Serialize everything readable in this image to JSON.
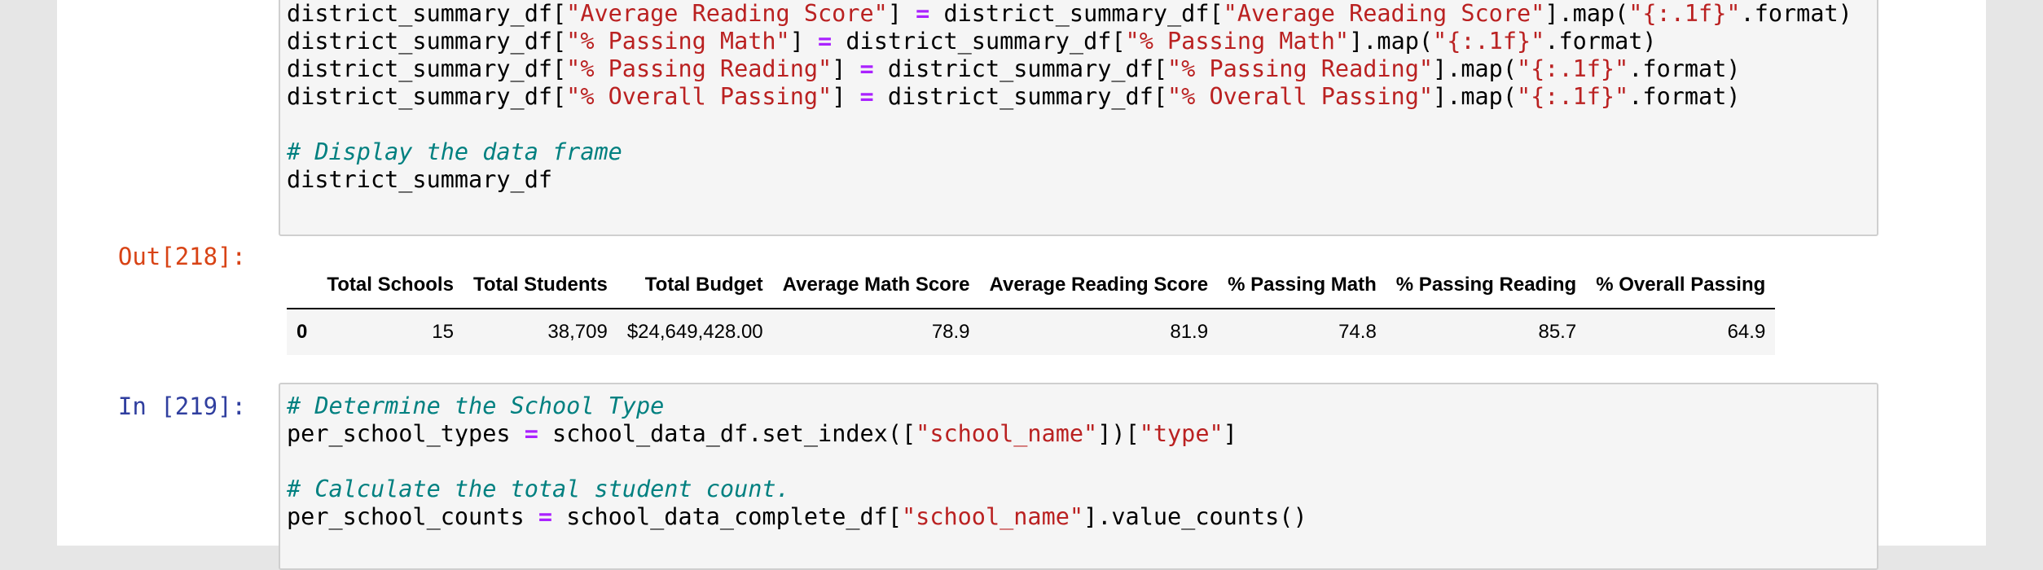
{
  "cell1": {
    "code_lines": [
      "district_summary_df[\"Average Reading Score\"] = district_summary_df[\"Average Reading Score\"].map(\"{:.1f}\".format)",
      "district_summary_df[\"% Passing Math\"] = district_summary_df[\"% Passing Math\"].map(\"{:.1f}\".format)",
      "district_summary_df[\"% Passing Reading\"] = district_summary_df[\"% Passing Reading\"].map(\"{:.1f}\".format)",
      "district_summary_df[\"% Overall Passing\"] = district_summary_df[\"% Overall Passing\"].map(\"{:.1f}\".format)",
      "",
      "# Display the data frame",
      "district_summary_df"
    ]
  },
  "output": {
    "prompt": "Out[218]:",
    "columns": [
      "",
      "Total Schools",
      "Total Students",
      "Total Budget",
      "Average Math Score",
      "Average Reading Score",
      "% Passing Math",
      "% Passing Reading",
      "% Overall Passing"
    ],
    "rows": [
      [
        "0",
        "15",
        "38,709",
        "$24,649,428.00",
        "78.9",
        "81.9",
        "74.8",
        "85.7",
        "64.9"
      ]
    ]
  },
  "cell2": {
    "prompt": "In [219]:",
    "code_lines": [
      "# Determine the School Type",
      "per_school_types = school_data_df.set_index([\"school_name\"])[\"type\"]",
      "",
      "# Calculate the total student count.",
      "per_school_counts = school_data_complete_df[\"school_name\"].value_counts()"
    ]
  },
  "colors": {
    "string": "#ba2121",
    "operator": "#aa22ff",
    "comment": "#008080",
    "out_prompt": "#d84315",
    "in_prompt": "#303f9f"
  }
}
